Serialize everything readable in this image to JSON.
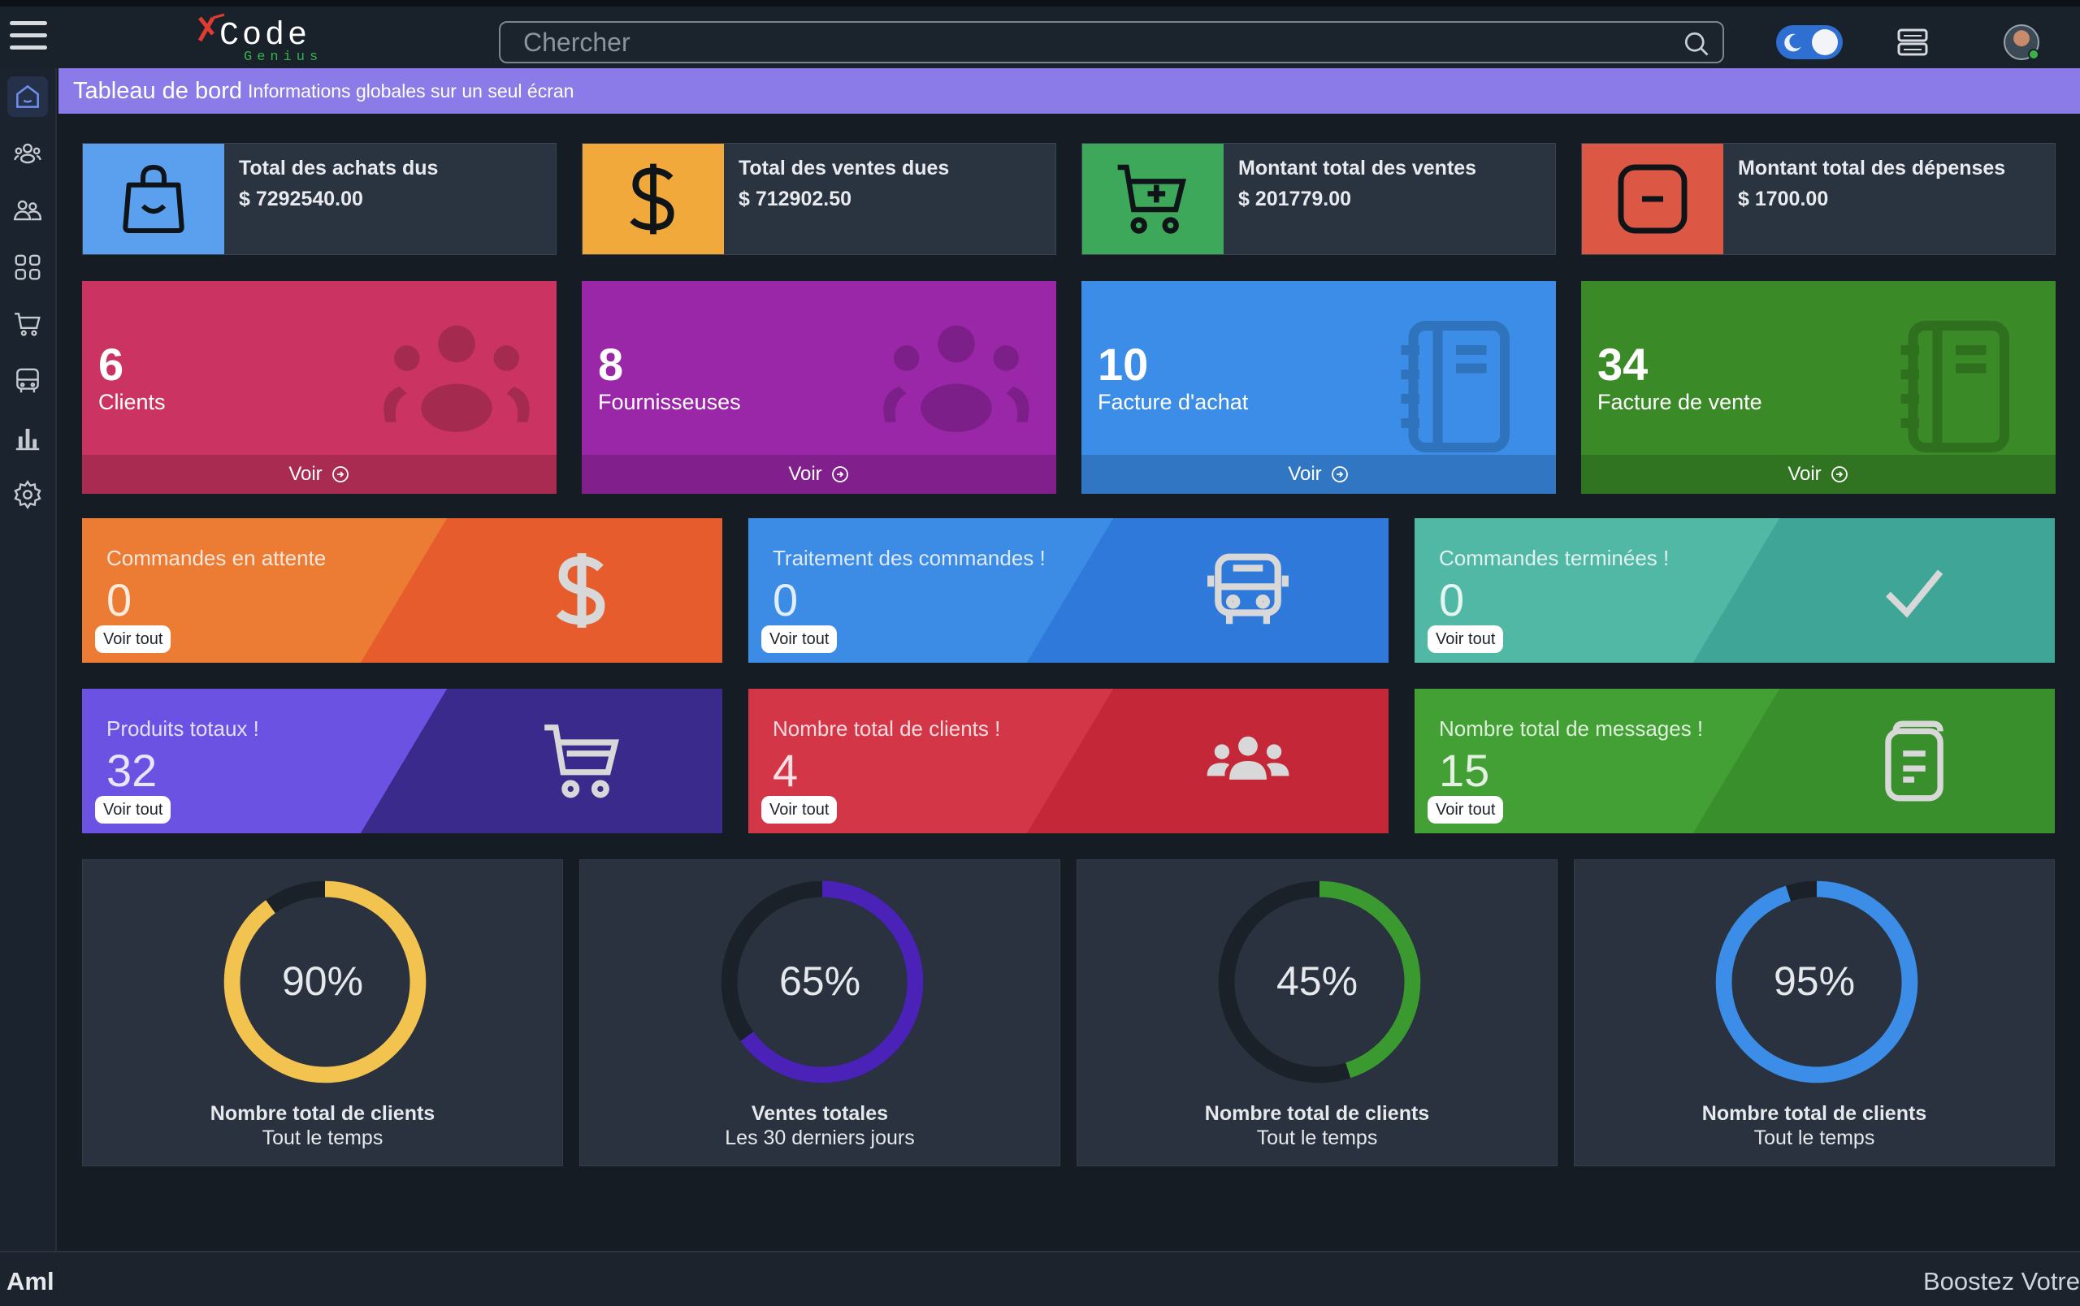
{
  "header": {
    "logo_main": "Code",
    "logo_sub": "Genius",
    "search_placeholder": "Chercher"
  },
  "sidebar": {
    "items": [
      "home-icon",
      "users-icon",
      "user-group-icon",
      "grid-icon",
      "cart-icon",
      "bus-icon",
      "bar-chart-icon",
      "gear-icon"
    ]
  },
  "breadcrumb": {
    "title": "Tableau de bord",
    "subtitle": "Informations globales sur un seul écran"
  },
  "stats": [
    {
      "label": "Total des achats dus",
      "value": "$ 7292540.00",
      "color": "#5aa0ef",
      "icon": "shopping-bag-icon"
    },
    {
      "label": "Total des ventes dues",
      "value": "$ 712902.50",
      "color": "#f0a93a",
      "icon": "dollar-icon"
    },
    {
      "label": "Montant total des ventes",
      "value": "$ 201779.00",
      "color": "#3ea85a",
      "icon": "cart-plus-icon"
    },
    {
      "label": "Montant total des dépenses",
      "value": "$ 1700.00",
      "color": "#dd5745",
      "icon": "minus-square-icon"
    }
  ],
  "counts": [
    {
      "number": "6",
      "caption": "Clients",
      "link": "Voir",
      "color": "#cb3462",
      "icon": "users-icon"
    },
    {
      "number": "8",
      "caption": "Fournisseuses",
      "link": "Voir",
      "color": "#9a26a8",
      "icon": "users-icon"
    },
    {
      "number": "10",
      "caption": "Facture d'achat",
      "link": "Voir",
      "color": "#3b8de8",
      "icon": "notebook-icon"
    },
    {
      "number": "34",
      "caption": "Facture de vente",
      "link": "Voir",
      "color": "#3a8a27",
      "icon": "notebook-icon"
    }
  ],
  "orders": [
    {
      "label": "Commandes en attente",
      "value": "0",
      "button": "Voir tout",
      "left": "#ec7c34",
      "right": "#e65c2c",
      "icon": "dollar-icon"
    },
    {
      "label": "Traitement des commandes !",
      "value": "0",
      "button": "Voir tout",
      "left": "#3c8ce6",
      "right": "#2f79da",
      "icon": "bus-icon"
    },
    {
      "label": "Commandes terminées !",
      "value": "0",
      "button": "Voir tout",
      "left": "#52b8a6",
      "right": "#3fa596",
      "icon": "check-icon"
    },
    {
      "label": "Produits totaux !",
      "value": "32",
      "button": "Voir tout",
      "left": "#6b52e2",
      "right": "#3a2a8c",
      "icon": "cart-icon"
    },
    {
      "label": "Nombre total de clients !",
      "value": "4",
      "button": "Voir tout",
      "left": "#d33747",
      "right": "#c42838",
      "icon": "users-icon"
    },
    {
      "label": "Nombre total de messages !",
      "value": "15",
      "button": "Voir tout",
      "left": "#43a035",
      "right": "#398f2b",
      "icon": "document-icon"
    }
  ],
  "gauges": [
    {
      "percent": 90,
      "label": "90%",
      "title": "Nombre total de clients",
      "subtitle": "Tout le temps",
      "color": "#f2c34f"
    },
    {
      "percent": 65,
      "label": "65%",
      "title": "Ventes totales",
      "subtitle": "Les 30 derniers jours",
      "color": "#4a22b8"
    },
    {
      "percent": 45,
      "label": "45%",
      "title": "Nombre total de clients",
      "subtitle": "Tout le temps",
      "color": "#3a9a2f"
    },
    {
      "percent": 95,
      "label": "95%",
      "title": "Nombre total de clients",
      "subtitle": "Tout le temps",
      "color": "#3b8de8"
    }
  ],
  "footer": {
    "left": "Aml",
    "ticker": "Boostez Votre"
  }
}
